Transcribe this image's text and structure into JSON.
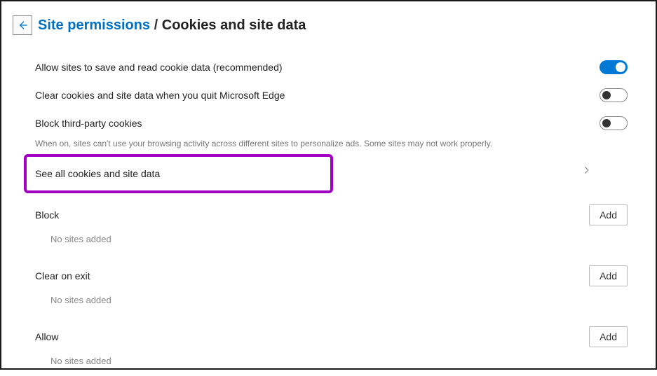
{
  "breadcrumb": {
    "link": "Site permissions",
    "separator": "/",
    "current": "Cookies and site data"
  },
  "settings": {
    "allow_cookies": {
      "label": "Allow sites to save and read cookie data (recommended)",
      "enabled": true
    },
    "clear_on_quit": {
      "label": "Clear cookies and site data when you quit Microsoft Edge",
      "enabled": false
    },
    "block_third_party": {
      "label": "Block third-party cookies",
      "description": "When on, sites can't use your browsing activity across different sites to personalize ads. Some sites may not work properly.",
      "enabled": false
    },
    "see_all": {
      "label": "See all cookies and site data"
    }
  },
  "sections": {
    "block": {
      "title": "Block",
      "add_label": "Add",
      "empty": "No sites added"
    },
    "clear_on_exit": {
      "title": "Clear on exit",
      "add_label": "Add",
      "empty": "No sites added"
    },
    "allow": {
      "title": "Allow",
      "add_label": "Add",
      "empty": "No sites added"
    }
  }
}
